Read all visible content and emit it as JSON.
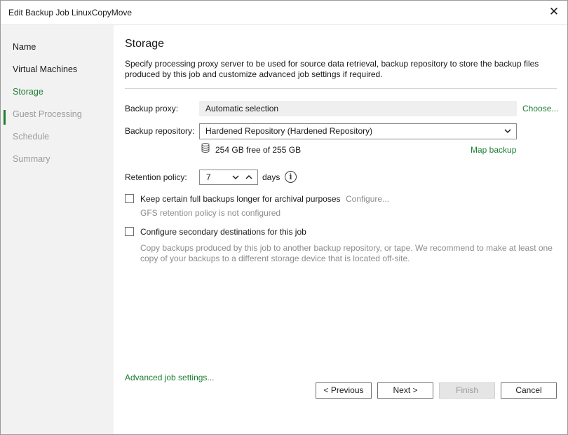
{
  "window": {
    "title": "Edit Backup Job LinuxCopyMove",
    "close_symbol": "✕"
  },
  "sidebar": {
    "items": [
      {
        "label": "Name",
        "state": "done"
      },
      {
        "label": "Virtual Machines",
        "state": "done"
      },
      {
        "label": "Storage",
        "state": "active"
      },
      {
        "label": "Guest Processing",
        "state": "pending"
      },
      {
        "label": "Schedule",
        "state": "pending"
      },
      {
        "label": "Summary",
        "state": "pending"
      }
    ]
  },
  "page": {
    "title": "Storage",
    "description": "Specify processing proxy server to be used for source data retrieval, backup repository to store the backup files produced by this job and customize advanced job settings if required."
  },
  "proxy": {
    "label": "Backup proxy:",
    "value": "Automatic selection",
    "choose_link": "Choose..."
  },
  "repository": {
    "label": "Backup repository:",
    "selected": "Hardened Repository (Hardened Repository)",
    "free_space": "254 GB free of 255 GB",
    "map_link": "Map backup",
    "icon": "database-icon"
  },
  "retention": {
    "label": "Retention policy:",
    "value": "7",
    "unit": "days",
    "info_symbol": "i"
  },
  "gfs": {
    "checkbox_label": "Keep certain full backups longer for archival purposes",
    "checked": false,
    "configure_link": "Configure...",
    "status": "GFS retention policy is not configured"
  },
  "secondary": {
    "checkbox_label": "Configure secondary destinations for this job",
    "checked": false,
    "hint": "Copy backups produced by this job to another backup repository, or tape. We recommend to make at least one copy of your backups to a different storage device that is located off-site."
  },
  "advanced_link": "Advanced job settings...",
  "buttons": {
    "previous": "< Previous",
    "next": "Next >",
    "finish": "Finish",
    "cancel": "Cancel"
  },
  "colors": {
    "accent": "#1e7e34",
    "sidebar_bg": "#f2f2f2",
    "muted_text": "#8c8c8c"
  }
}
